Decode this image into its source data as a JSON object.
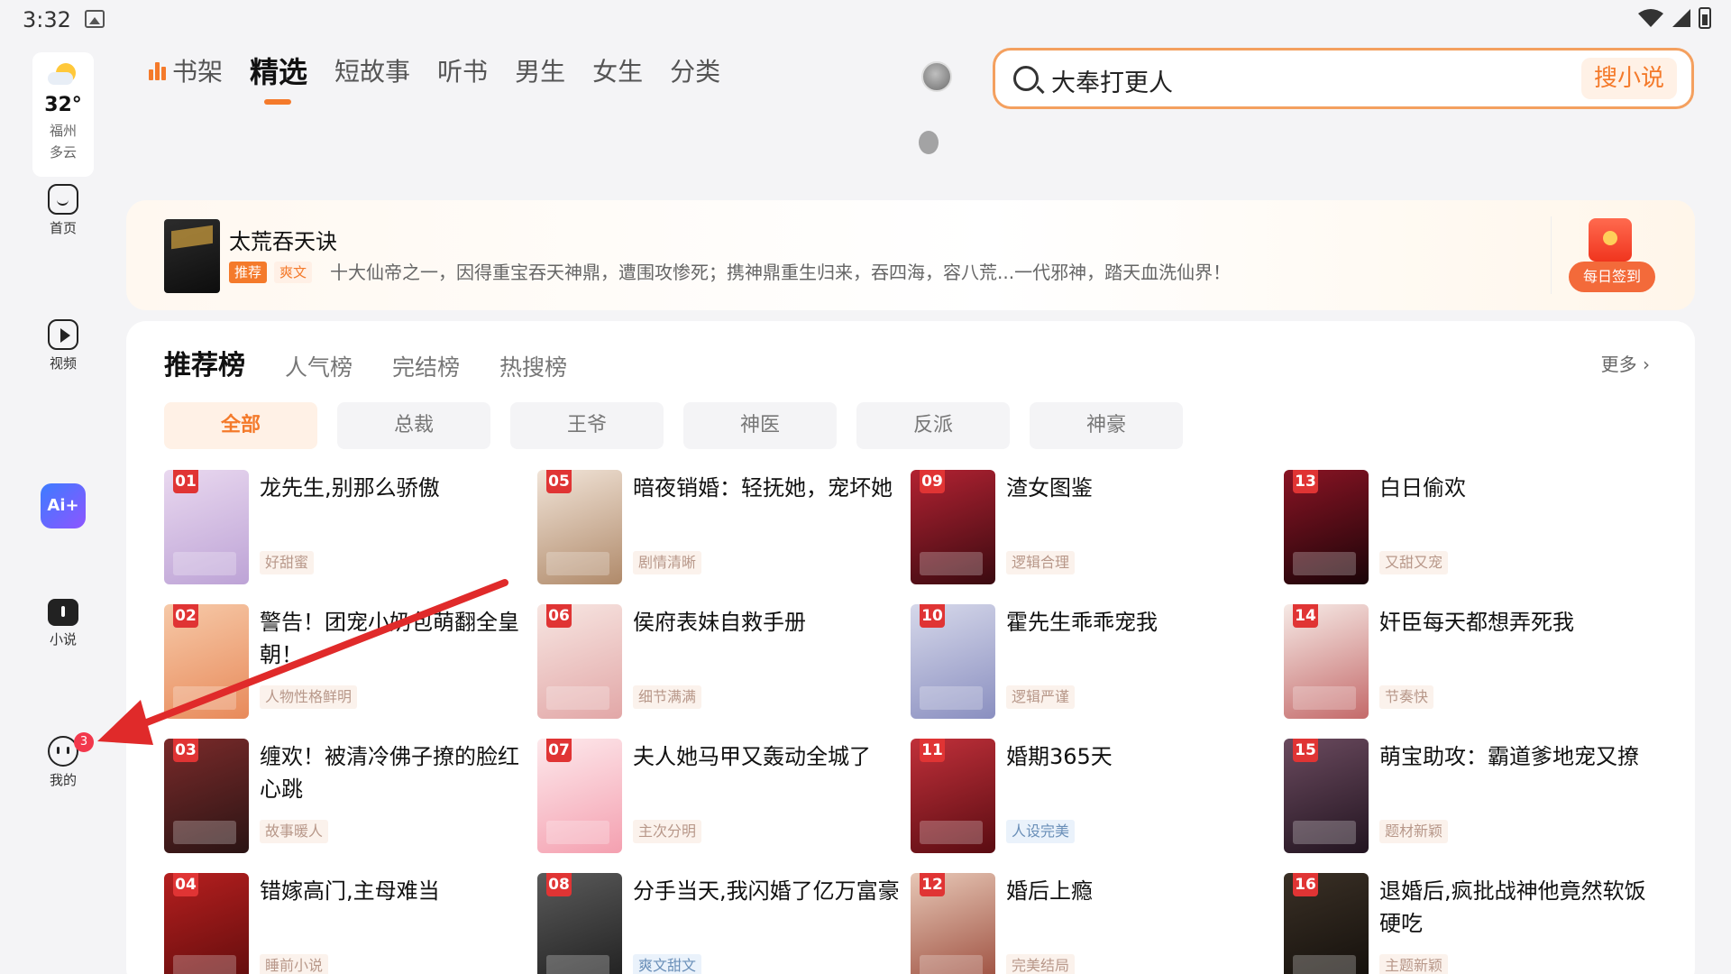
{
  "status_bar": {
    "time": "3:32"
  },
  "weather": {
    "temp": "32°",
    "city": "福州",
    "condition": "多云"
  },
  "side_nav": [
    {
      "label": "首页",
      "icon": "home-icon"
    },
    {
      "label": "视频",
      "icon": "video-icon"
    },
    {
      "label": "",
      "icon": "ai-icon",
      "glyph": "Ai+"
    },
    {
      "label": "小说",
      "icon": "novel-icon"
    },
    {
      "label": "我的",
      "icon": "profile-icon",
      "badge": "3"
    }
  ],
  "top_tabs": [
    {
      "label": "书架",
      "active": false
    },
    {
      "label": "精选",
      "active": true
    },
    {
      "label": "短故事",
      "active": false
    },
    {
      "label": "听书",
      "active": false
    },
    {
      "label": "男生",
      "active": false
    },
    {
      "label": "女生",
      "active": false
    },
    {
      "label": "分类",
      "active": false
    }
  ],
  "search": {
    "value": "大奉打更人",
    "button": "搜小说"
  },
  "promo": {
    "title": "太荒吞天诀",
    "tag_recommend": "推荐",
    "tag_genre": "爽文",
    "description": "十大仙帝之一，因得重宝吞天神鼎，遭围攻惨死；携神鼎重生归来，吞四海，容八荒...一代邪神，踏天血洗仙界！",
    "signin_label": "每日签到"
  },
  "rank": {
    "tabs": [
      "推荐榜",
      "人气榜",
      "完结榜",
      "热搜榜"
    ],
    "more": "更多",
    "chips": [
      "全部",
      "总裁",
      "王爷",
      "神医",
      "反派",
      "神豪"
    ],
    "books": [
      {
        "rank": "01",
        "title": "龙先生,别那么骄傲",
        "tag": "好甜蜜",
        "tag_style": "warm",
        "cover": [
          "#e9d8ef",
          "#bda3d6"
        ]
      },
      {
        "rank": "02",
        "title": "警告！团宠小奶包萌翻全皇朝！",
        "tag": "人物性格鲜明",
        "tag_style": "warm",
        "cover": [
          "#f6c9a8",
          "#e88a5a"
        ]
      },
      {
        "rank": "03",
        "title": "缠欢！被清冷佛子撩的脸红心跳",
        "tag": "故事暖人",
        "tag_style": "warm",
        "cover": [
          "#7a2a2a",
          "#2a1414"
        ]
      },
      {
        "rank": "04",
        "title": "错嫁高门,主母难当",
        "tag": "睡前小说",
        "tag_style": "warm",
        "cover": [
          "#b51f1f",
          "#5e0c0c"
        ]
      },
      {
        "rank": "05",
        "title": "暗夜销婚：轻抚她，宠坏她",
        "tag": "剧情清晰",
        "tag_style": "warm",
        "cover": [
          "#f1e4d8",
          "#b08a6a"
        ]
      },
      {
        "rank": "06",
        "title": "侯府表妹自救手册",
        "tag": "细节满满",
        "tag_style": "warm",
        "cover": [
          "#f7e6e2",
          "#e2a7a7"
        ]
      },
      {
        "rank": "07",
        "title": "夫人她马甲又轰动全城了",
        "tag": "主次分明",
        "tag_style": "warm",
        "cover": [
          "#fde9ec",
          "#f4a0b0"
        ]
      },
      {
        "rank": "08",
        "title": "分手当天,我闪婚了亿万富豪",
        "tag": "爽文甜文",
        "tag_style": "blue",
        "cover": [
          "#5a5a5a",
          "#1e1e1e"
        ]
      },
      {
        "rank": "09",
        "title": "渣女图鉴",
        "tag": "逻辑合理",
        "tag_style": "warm",
        "cover": [
          "#b22232",
          "#3a0a10"
        ]
      },
      {
        "rank": "10",
        "title": "霍先生乖乖宠我",
        "tag": "逻辑严谨",
        "tag_style": "warm",
        "cover": [
          "#d6d8ea",
          "#8a8fc0"
        ]
      },
      {
        "rank": "11",
        "title": "婚期365天",
        "tag": "人设完美",
        "tag_style": "blue",
        "cover": [
          "#c0303a",
          "#5a0c12"
        ]
      },
      {
        "rank": "12",
        "title": "婚后上瘾",
        "tag": "完美结局",
        "tag_style": "warm",
        "cover": [
          "#e7c7b6",
          "#9a4a3a"
        ]
      },
      {
        "rank": "13",
        "title": "白日偷欢",
        "tag": "又甜又宠",
        "tag_style": "warm",
        "cover": [
          "#8a1424",
          "#1a0408"
        ]
      },
      {
        "rank": "14",
        "title": "奸臣每天都想弄死我",
        "tag": "节奏快",
        "tag_style": "warm",
        "cover": [
          "#f6eae6",
          "#c46a6a"
        ]
      },
      {
        "rank": "15",
        "title": "萌宝助攻：霸道爹地宠又撩",
        "tag": "题材新颖",
        "tag_style": "warm",
        "cover": [
          "#6a4a5e",
          "#221420"
        ]
      },
      {
        "rank": "16",
        "title": "退婚后,疯批战神他竟然软饭硬吃",
        "tag": "主题新颖",
        "tag_style": "warm",
        "cover": [
          "#3a3026",
          "#120e0a"
        ]
      }
    ]
  },
  "colors": {
    "accent": "#f47a2b",
    "badge": "#f2384c",
    "rank_red": "#e03434",
    "arrow": "#e02a2a"
  }
}
